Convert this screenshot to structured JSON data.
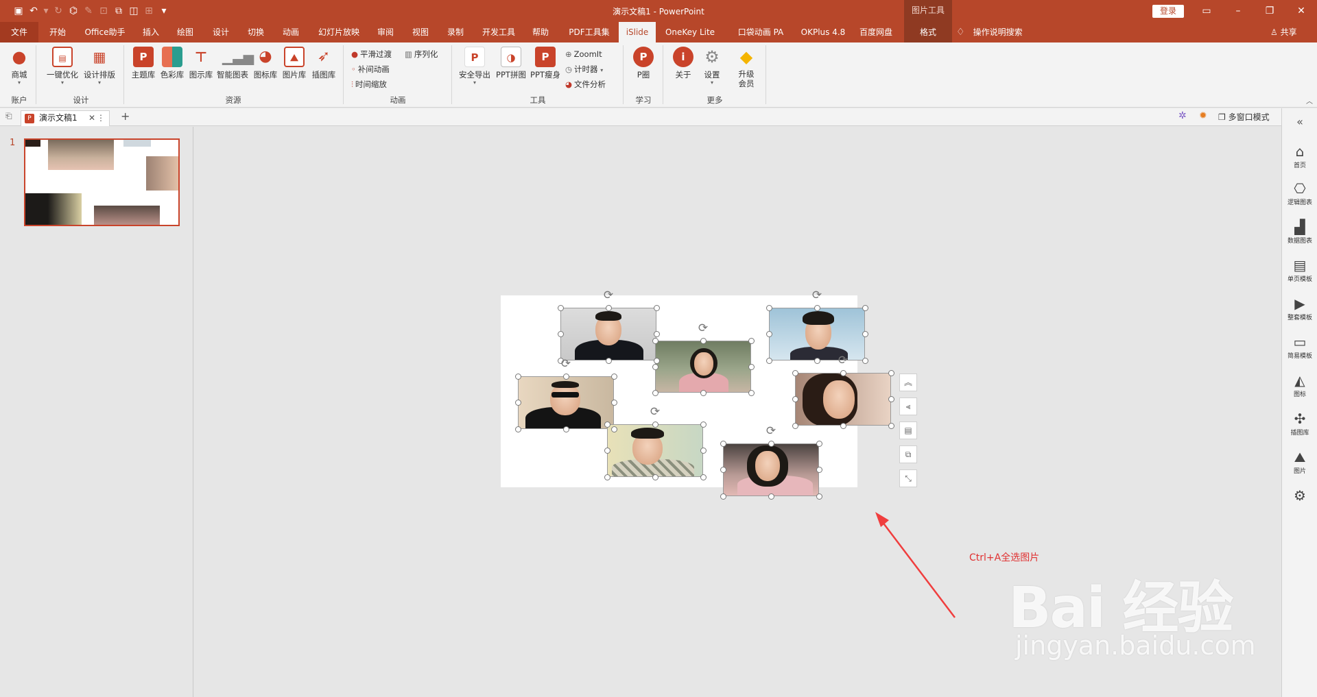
{
  "titlebar": {
    "doc_title": "演示文稿1  -  PowerPoint",
    "context_label": "图片工具",
    "login": "登录",
    "quick_access": [
      "save-icon",
      "undo-icon",
      "redo-icon",
      "preview-icon",
      "brush-icon",
      "crop-icon",
      "group-icon",
      "arrange-icon",
      "ungroup-icon",
      "customize-icon"
    ]
  },
  "menu": {
    "tabs": [
      "文件",
      "开始",
      "Office助手",
      "插入",
      "绘图",
      "设计",
      "切换",
      "动画",
      "幻灯片放映",
      "审阅",
      "视图",
      "录制",
      "开发工具",
      "帮助",
      "PDF工具集",
      "iSlide",
      "OneKey Lite",
      "口袋动画 PA",
      "OKPlus 4.8",
      "百度网盘",
      "格式"
    ],
    "search": "操作说明搜索",
    "share": "共享"
  },
  "ribbon": {
    "account": "商城",
    "yijian": "一键优化",
    "sheji_paiban": "设计排版",
    "zhuti": "主题库",
    "secai": "色彩库",
    "tushi": "图示库",
    "zhineng": "智能图表",
    "tubiao": "图标库",
    "tupian": "图片库",
    "chatu": "插图库",
    "pinghua": "平滑过渡",
    "xulie": "序列化",
    "bujian": "补间动画",
    "shijian": "时间缩放",
    "anquan": "安全导出",
    "pintu": "PPT拼图",
    "shoushen": "PPT瘦身",
    "zoomit": "ZoomIt",
    "jishiqi": "计时器",
    "wenjian": "文件分析",
    "pquan": "P圈",
    "guanyu": "关于",
    "shezhi": "设置",
    "shengji": "升级会员",
    "groups": {
      "account": "账户",
      "design": "设计",
      "resource": "资源",
      "animation": "动画",
      "tools": "工具",
      "learn": "学习",
      "more": "更多"
    }
  },
  "tabstrip": {
    "doc_tab": "演示文稿1",
    "multi_window": "多窗口模式"
  },
  "thumbnails": {
    "slide_number": "1"
  },
  "canvas": {
    "annotation": "Ctrl+A全选图片",
    "watermark_logo": "Bai 经验",
    "watermark_url": "jingyan.baidu.com"
  },
  "rightbar": {
    "items": [
      "首页",
      "逻辑图表",
      "数据图表",
      "单页模板",
      "整套模板",
      "简易模板",
      "图标",
      "插图库",
      "图片"
    ]
  },
  "colors": {
    "accent": "#b7472a",
    "annotation": "#e03131"
  }
}
